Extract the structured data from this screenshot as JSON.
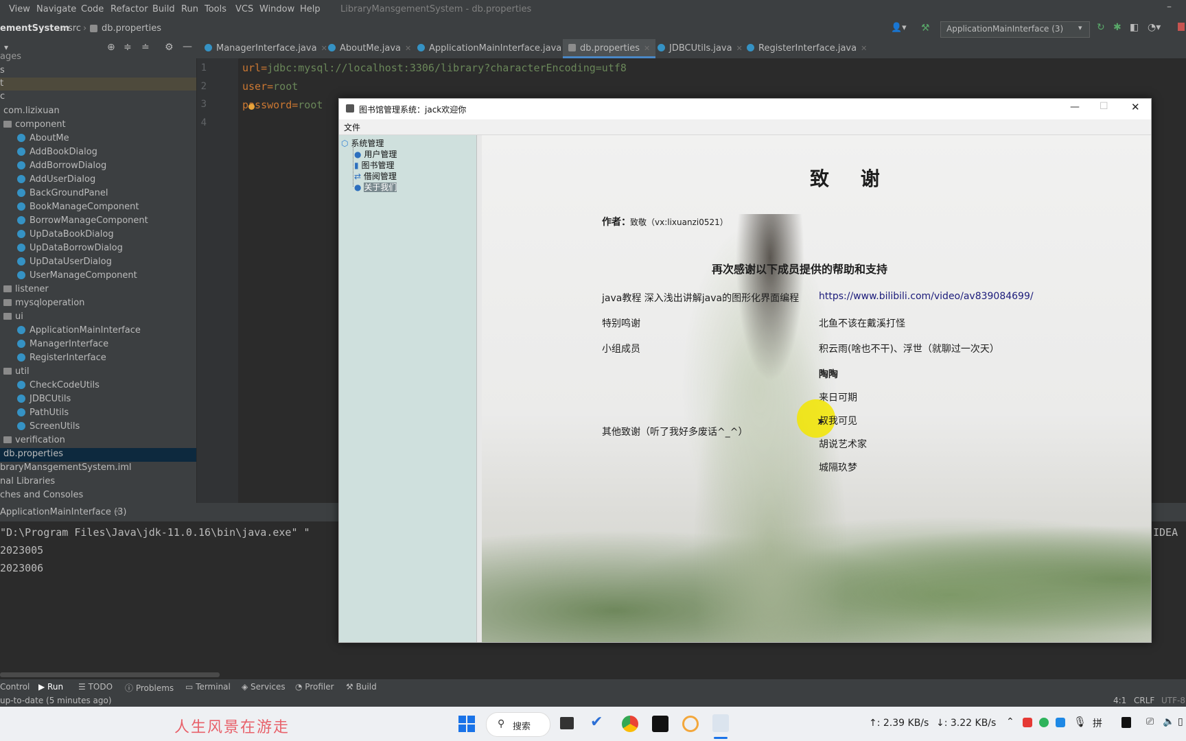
{
  "ide": {
    "menu": [
      "View",
      "Navigate",
      "Code",
      "Refactor",
      "Build",
      "Run",
      "Tools",
      "VCS",
      "Window",
      "Help"
    ],
    "window_title": "LibraryMansgementSystem - db.properties",
    "breadcrumb": {
      "project": "ementSystem",
      "src": "src",
      "file": "db.properties"
    },
    "run_config": "ApplicationMainInterface (3)",
    "tabs": [
      "ManagerInterface.java",
      "AboutMe.java",
      "ApplicationMainInterface.java",
      "db.properties",
      "JDBCUtils.java",
      "RegisterInterface.java"
    ],
    "active_tab": "db.properties",
    "tree": {
      "ages": "ages",
      "s": "s",
      "t": "t",
      "c": "c",
      "root_pkg": "com.lizixuan",
      "component": "component",
      "component_items": [
        "AboutMe",
        "AddBookDialog",
        "AddBorrowDialog",
        "AddUserDialog",
        "BackGroundPanel",
        "BookManageComponent",
        "BorrowManageComponent",
        "UpDataBookDialog",
        "UpDataBorrowDialog",
        "UpDataUserDialog",
        "UserManageComponent"
      ],
      "listener": "listener",
      "mysqloperation": "mysqloperation",
      "ui": "ui",
      "ui_items": [
        "ApplicationMainInterface",
        "ManagerInterface",
        "RegisterInterface"
      ],
      "util": "util",
      "util_items": [
        "CheckCodeUtils",
        "JDBCUtils",
        "PathUtils",
        "ScreenUtils"
      ],
      "verification": "verification",
      "db_file": "db.properties",
      "iml": "braryMansgementSystem.iml",
      "ext_libs": "nal Libraries",
      "scratches": "ches and Consoles"
    },
    "code": {
      "line_numbers": [
        "1",
        "2",
        "3",
        "4"
      ],
      "line1_key": "url",
      "line1_val": "jdbc:mysql://localhost:3306/library?characterEncoding=utf8",
      "line2_key": "user",
      "line2_val": "root",
      "line3_key": "password",
      "line3_val": "root",
      "eq": "="
    },
    "run_tab": "ApplicationMainInterface (3)",
    "console": [
      "\"D:\\Program Files\\Java\\jdk-11.0.16\\bin\\java.exe\" \"",
      "2023005",
      "2023006"
    ],
    "console_tail": "IDEA",
    "toolwindows": [
      "Control",
      "Run",
      "TODO",
      "Problems",
      "Terminal",
      "Services",
      "Profiler",
      "Build"
    ],
    "status_left": "up-to-date (5 minutes ago)",
    "status_right": [
      "4:1",
      "CRLF",
      "UTF-8"
    ]
  },
  "app": {
    "title": "图书馆管理系统：jack欢迎你",
    "menu_file": "文件",
    "tree_root": "系统管理",
    "tree_items": [
      "用户管理",
      "图书管理",
      "借阅管理",
      "关于我们"
    ],
    "selected_item": "关于我们",
    "heading": "致 谢",
    "author_label": "作者：",
    "author_value": "致敬（vx:lixuanzi0521）",
    "thanks_line": "再次感谢以下成员提供的帮助和支持",
    "rows": [
      {
        "label": "java教程 深入浅出讲解java的图形化界面编程",
        "value": "https://www.bilibili.com/video/av839084699/"
      },
      {
        "label": "特别鸣谢",
        "value": "北鱼不该在戴溪打怪"
      },
      {
        "label": "小组成员",
        "value": "积云雨(啥也不干)、浮世（就聊过一次天）"
      }
    ],
    "members_more": [
      "陶陶",
      "来日可期",
      "叔我可见",
      "胡说艺术家",
      "城隔玖梦"
    ],
    "other_label": "其他致谢（听了我好多废话^_^）"
  },
  "taskbar": {
    "watermark": "人生风景在游走",
    "search": "搜索",
    "net_up": "↑: 2.39 KB/s",
    "net_down": "↓: 3.22 KB/s"
  },
  "colors": {
    "accent": "#4a88c7",
    "cursor_highlight": "#f3e600"
  }
}
